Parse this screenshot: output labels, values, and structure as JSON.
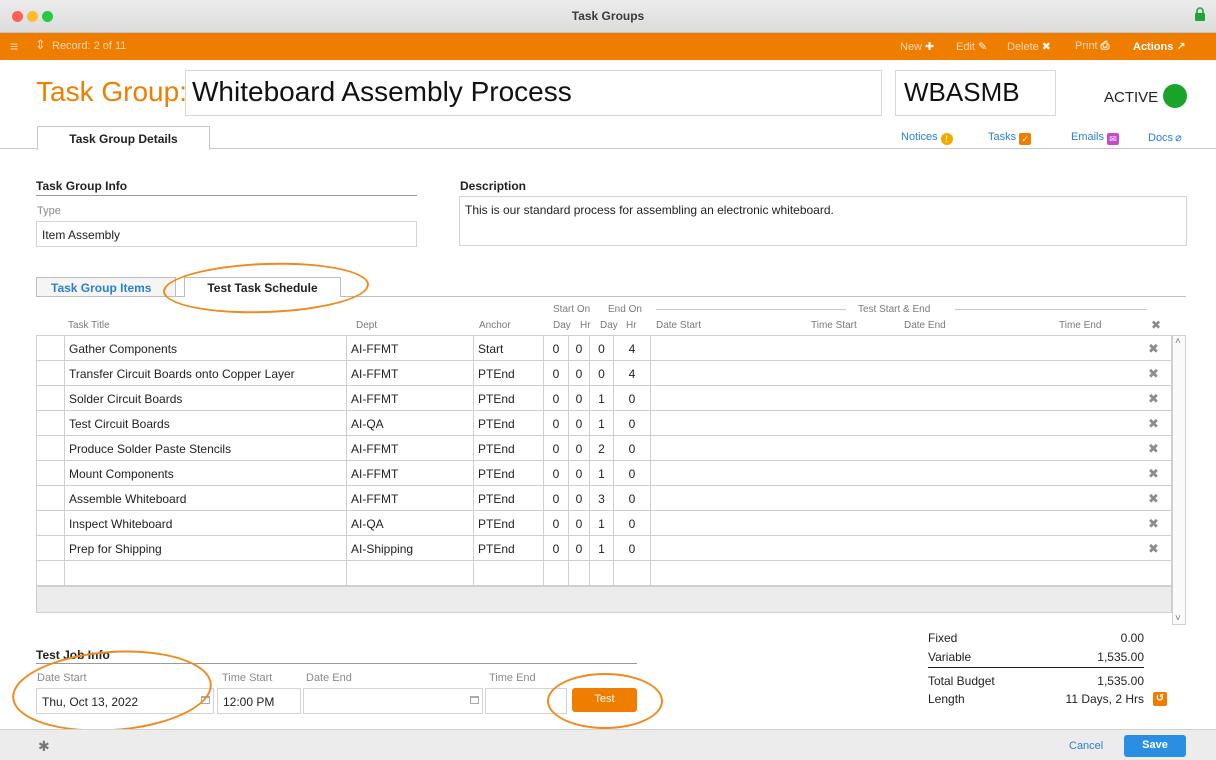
{
  "window": {
    "title": "Task Groups"
  },
  "toolbar": {
    "record_label": "Record: 2 of 11",
    "new_label": "New",
    "edit_label": "Edit",
    "delete_label": "Delete",
    "print_label": "Print",
    "actions_label": "Actions"
  },
  "header": {
    "label": "Task Group:",
    "name": "Whiteboard Assembly Process",
    "code": "WBASMB",
    "status": "ACTIVE",
    "status_color": "#1aa32a"
  },
  "main_tab": {
    "label": "Task Group Details"
  },
  "doc_links": {
    "notices": "Notices",
    "tasks": "Tasks",
    "emails": "Emails",
    "docs": "Docs"
  },
  "info": {
    "section_title": "Task Group Info",
    "type_label": "Type",
    "type_value": "Item Assembly"
  },
  "description": {
    "section_title": "Description",
    "text": "This is our standard process for assembling an electronic whiteboard."
  },
  "sub_tabs": {
    "items": "Task Group Items",
    "schedule": "Test Task Schedule"
  },
  "grid": {
    "group_start_on": "Start On",
    "group_end_on": "End On",
    "group_test": "Test Start & End",
    "headers": {
      "title": "Task Title",
      "dept": "Dept",
      "anchor": "Anchor",
      "start_day": "Day",
      "start_hr": "Hr",
      "end_day": "Day",
      "end_hr": "Hr",
      "date_start": "Date Start",
      "time_start": "Time Start",
      "date_end": "Date End",
      "time_end": "Time End"
    },
    "rows": [
      {
        "title": "Gather Components",
        "dept": "AI-FFMT",
        "anchor": "Start",
        "sd": "0",
        "sh": "0",
        "ed": "0",
        "eh": "4"
      },
      {
        "title": "Transfer Circuit Boards onto Copper Layer",
        "dept": "AI-FFMT",
        "anchor": "PTEnd",
        "sd": "0",
        "sh": "0",
        "ed": "0",
        "eh": "4"
      },
      {
        "title": "Solder Circuit Boards",
        "dept": "AI-FFMT",
        "anchor": "PTEnd",
        "sd": "0",
        "sh": "0",
        "ed": "1",
        "eh": "0"
      },
      {
        "title": "Test Circuit Boards",
        "dept": "AI-QA",
        "anchor": "PTEnd",
        "sd": "0",
        "sh": "0",
        "ed": "1",
        "eh": "0"
      },
      {
        "title": "Produce Solder Paste Stencils",
        "dept": "AI-FFMT",
        "anchor": "PTEnd",
        "sd": "0",
        "sh": "0",
        "ed": "2",
        "eh": "0"
      },
      {
        "title": "Mount Components",
        "dept": "AI-FFMT",
        "anchor": "PTEnd",
        "sd": "0",
        "sh": "0",
        "ed": "1",
        "eh": "0"
      },
      {
        "title": "Assemble Whiteboard",
        "dept": "AI-FFMT",
        "anchor": "PTEnd",
        "sd": "0",
        "sh": "0",
        "ed": "3",
        "eh": "0"
      },
      {
        "title": "Inspect Whiteboard",
        "dept": "AI-QA",
        "anchor": "PTEnd",
        "sd": "0",
        "sh": "0",
        "ed": "1",
        "eh": "0"
      },
      {
        "title": "Prep for Shipping",
        "dept": "AI-Shipping",
        "anchor": "PTEnd",
        "sd": "0",
        "sh": "0",
        "ed": "1",
        "eh": "0"
      }
    ]
  },
  "budget": {
    "fixed_label": "Fixed",
    "fixed_value": "0.00",
    "variable_label": "Variable",
    "variable_value": "1,535.00",
    "total_label": "Total Budget",
    "total_value": "1,535.00",
    "length_label": "Length",
    "length_value": "11 Days, 2 Hrs"
  },
  "test_job": {
    "section_title": "Test Job Info",
    "date_start_label": "Date Start",
    "date_start_value": "Thu, Oct 13, 2022",
    "time_start_label": "Time Start",
    "time_start_value": "12:00 PM",
    "date_end_label": "Date End",
    "date_end_value": "",
    "time_end_label": "Time End",
    "time_end_value": "",
    "test_button": "Test"
  },
  "footer": {
    "cancel": "Cancel",
    "save": "Save"
  },
  "colors": {
    "accent": "#ef7d00",
    "link": "#2a7fd4",
    "save": "#2a8fe0"
  }
}
